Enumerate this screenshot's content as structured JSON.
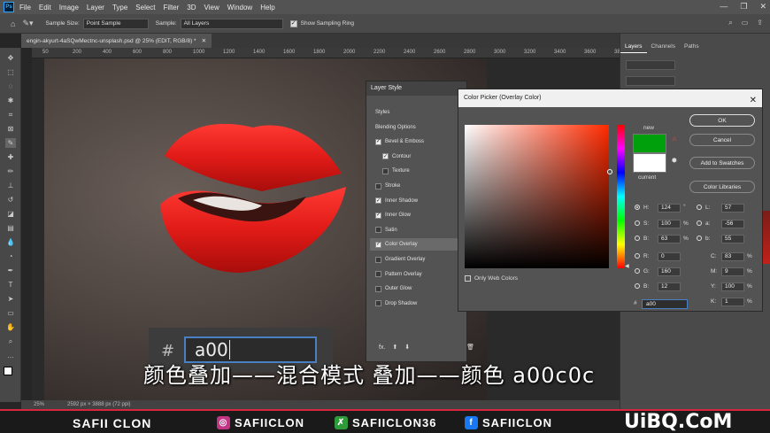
{
  "menubar": {
    "items": [
      "File",
      "Edit",
      "Image",
      "Layer",
      "Type",
      "Select",
      "Filter",
      "3D",
      "View",
      "Window",
      "Help"
    ]
  },
  "optionsbar": {
    "sample_size_label": "Sample Size:",
    "sample_size_value": "Point Sample",
    "sample_label": "Sample:",
    "sample_value": "All Layers",
    "show_ring_label": "Show Sampling Ring"
  },
  "document": {
    "tab_title": "engin-akyurt-4aSQwMectnc-unsplash.psd @ 25% (EDIT, RGB/8) *",
    "ruler_ticks": [
      "50",
      "200",
      "400",
      "600",
      "800",
      "1000",
      "1200",
      "1400",
      "1600",
      "1800",
      "2000",
      "2200",
      "2400",
      "2600",
      "2800",
      "3000",
      "3200",
      "3400",
      "3600",
      "3800"
    ],
    "status_zoom": "25%",
    "status_size": "2592 px × 3888 px (72 ppi)"
  },
  "panels": {
    "tabs": [
      "Layers",
      "Channels",
      "Paths"
    ]
  },
  "layer_style": {
    "title": "Layer Style",
    "items": [
      {
        "label": "Styles",
        "checkbox": "none"
      },
      {
        "label": "Blending Options",
        "checkbox": "none"
      },
      {
        "label": "Bevel & Emboss",
        "checkbox": "on"
      },
      {
        "label": "Contour",
        "checkbox": "on"
      },
      {
        "label": "Texture",
        "checkbox": "off"
      },
      {
        "label": "Stroke",
        "checkbox": "off"
      },
      {
        "label": "Inner Shadow",
        "checkbox": "on"
      },
      {
        "label": "Inner Glow",
        "checkbox": "on"
      },
      {
        "label": "Satin",
        "checkbox": "off"
      },
      {
        "label": "Color Overlay",
        "checkbox": "on"
      },
      {
        "label": "Gradient Overlay",
        "checkbox": "off"
      },
      {
        "label": "Pattern Overlay",
        "checkbox": "off"
      },
      {
        "label": "Outer Glow",
        "checkbox": "off"
      },
      {
        "label": "Drop Shadow",
        "checkbox": "off"
      }
    ],
    "footer_fx": "fx."
  },
  "color_picker": {
    "title": "Color Picker (Overlay Color)",
    "new_label": "new",
    "current_label": "current",
    "new_color": "#00a00c",
    "current_color": "#ffffff",
    "buttons": {
      "ok": "OK",
      "cancel": "Cancel",
      "add_swatches": "Add to Swatches",
      "libraries": "Color Libraries"
    },
    "fields": {
      "H": {
        "label": "H:",
        "value": "124",
        "unit": "°"
      },
      "S": {
        "label": "S:",
        "value": "100",
        "unit": "%"
      },
      "B": {
        "label": "B:",
        "value": "63",
        "unit": "%"
      },
      "R": {
        "label": "R:",
        "value": "0"
      },
      "G": {
        "label": "G:",
        "value": "160"
      },
      "Bl": {
        "label": "B:",
        "value": "12"
      },
      "L": {
        "label": "L:",
        "value": "57"
      },
      "a": {
        "label": "a:",
        "value": "-56"
      },
      "b": {
        "label": "b:",
        "value": "55"
      },
      "C": {
        "label": "C:",
        "value": "83",
        "unit": "%"
      },
      "M": {
        "label": "M:",
        "value": "9",
        "unit": "%"
      },
      "Y": {
        "label": "Y:",
        "value": "100",
        "unit": "%"
      },
      "K": {
        "label": "K:",
        "value": "1",
        "unit": "%"
      }
    },
    "hex_label": "#",
    "hex_value": "a00",
    "only_web_colors": "Only Web Colors",
    "gradient_hue_color": "#ff2a00"
  },
  "overlay": {
    "hash": "#",
    "typed_value": "a00"
  },
  "subtitle": "颜色叠加——混合模式  叠加——颜色  a00c0c",
  "banner": {
    "name": "SAFII CLON",
    "instagram": "SAFIICLON",
    "vector": "SAFIICLON36",
    "facebook": "SAFIICLON",
    "accent": "#d7263d"
  },
  "watermark": "UiBQ.CoM"
}
